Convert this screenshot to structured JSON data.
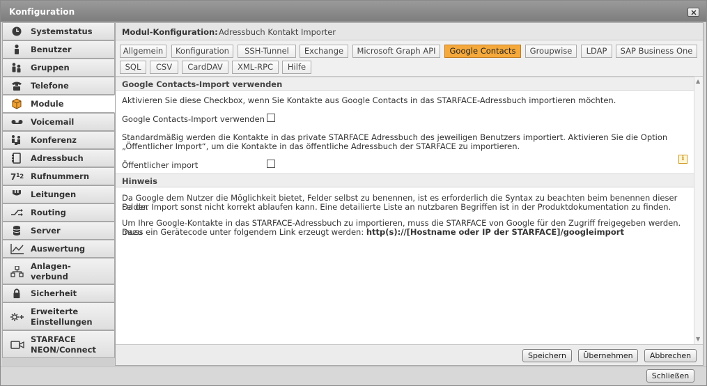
{
  "window": {
    "title": "Konfiguration",
    "close_icon": "close-icon"
  },
  "sidebar": {
    "items": [
      {
        "label": "Systemstatus",
        "icon": "clock-icon"
      },
      {
        "label": "Benutzer",
        "icon": "user-icon"
      },
      {
        "label": "Gruppen",
        "icon": "group-icon"
      },
      {
        "label": "Telefone",
        "icon": "phone-icon"
      },
      {
        "label": "Module",
        "icon": "cube-icon",
        "active": true
      },
      {
        "label": "Voicemail",
        "icon": "voicemail-icon"
      },
      {
        "label": "Konferenz",
        "icon": "conference-icon"
      },
      {
        "label": "Adressbuch",
        "icon": "addressbook-icon"
      },
      {
        "label": "Rufnummern",
        "icon": "numbers-icon"
      },
      {
        "label": "Leitungen",
        "icon": "lines-icon"
      },
      {
        "label": "Routing",
        "icon": "routing-icon"
      },
      {
        "label": "Server",
        "icon": "server-icon"
      },
      {
        "label": "Auswertung",
        "icon": "chart-icon"
      },
      {
        "label_line1": "Anlagen-",
        "label_line2": "verbund",
        "icon": "network-icon"
      },
      {
        "label": "Sicherheit",
        "icon": "lock-icon"
      },
      {
        "label_line1": "Erweiterte",
        "label_line2": "Einstellungen",
        "icon": "settings-plus-icon"
      },
      {
        "label_line1": "STARFACE",
        "label_line2": "NEON/Connect",
        "icon": "video-icon"
      }
    ]
  },
  "module": {
    "label": "Modul-Konfiguration:",
    "name": "Adressbuch Kontakt Importer"
  },
  "tabs": {
    "row1": [
      "Allgemein",
      "Konfiguration",
      "SSH-Tunnel",
      "Exchange",
      "Microsoft Graph API",
      "Google Contacts",
      "Groupwise",
      "LDAP",
      "SAP Business One"
    ],
    "row2": [
      "SQL",
      "CSV",
      "CardDAV",
      "XML-RPC",
      "Hilfe"
    ],
    "active": "Google Contacts"
  },
  "section1": {
    "title": "Google Contacts-Import verwenden",
    "intro": "Aktivieren Sie diese Checkbox, wenn Sie Kontakte aus Google Contacts in das STARFACE-Adressbuch importieren möchten.",
    "checkbox1_label": "Google Contacts-Import verwenden",
    "checkbox1_checked": false,
    "desc_line1": "Standardmäßig werden die Kontakte in das private STARFACE Adressbuch des jeweiligen Benutzers importiert. Aktivieren Sie die Option",
    "desc_line2": "„Öffentlicher Import“, um die Kontakte in das öffentliche Adressbuch der STARFACE zu importieren.",
    "checkbox2_label": "Öffentlicher import",
    "checkbox2_checked": false,
    "info_icon": "i"
  },
  "section2": {
    "title": "Hinweis",
    "p1_line1": "Da Google dem Nutzer die Möglichkeit bietet, Felder selbst zu benennen, ist es erforderlich die Syntax zu beachten beim benennen dieser Felder.",
    "p1_line2": "Da der Import sonst nicht korrekt ablaufen kann. Eine detailierte Liste an nutzbaren Begriffen ist in der Produktdokumentation zu finden.",
    "p2_line1": "Um Ihre Google-Kontakte in das STARFACE-Adressbuch zu importieren, muss die STARFACE von Google für den Zugriff freigegeben werden. Dazu",
    "p2_line2_prefix": "muss ein Gerätecode unter folgendem Link erzeugt werden:",
    "p2_link": "http(s)://[Hostname oder IP der STARFACE]/googleimport"
  },
  "footer": {
    "save": "Speichern",
    "apply": "Übernehmen",
    "cancel": "Abbrechen"
  },
  "bottom": {
    "close": "Schließen"
  }
}
